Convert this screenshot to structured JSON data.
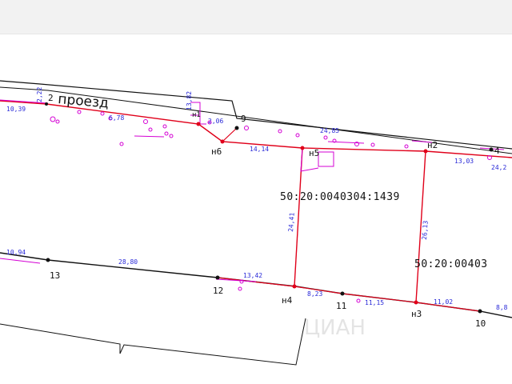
{
  "colors": {
    "boundary": "#e0001a",
    "outline": "#111111",
    "utility": "#d400d4",
    "dimension": "#2a2ad8",
    "topbar": "#f2f2f2"
  },
  "map": {
    "road_label": "проезд",
    "road_number": "2",
    "parcel_ids": [
      "50:20:0040304:1439",
      "50:20:00403"
    ],
    "point_labels": [
      "н6",
      "н5",
      "н4",
      "н3",
      "н2",
      "н1",
      "9",
      "4",
      "13",
      "12",
      "11",
      "10"
    ],
    "dimensions": [
      "10,39",
      "6,78",
      "2,06",
      "14,14",
      "24,85",
      "24,41",
      "26,13",
      "13,03",
      "10,94",
      "28,80",
      "13,42",
      "8,23",
      "11,15",
      "11,02",
      "8,8",
      "13,82",
      "24,2",
      "2,22"
    ],
    "watermark": "ЦИАН"
  }
}
